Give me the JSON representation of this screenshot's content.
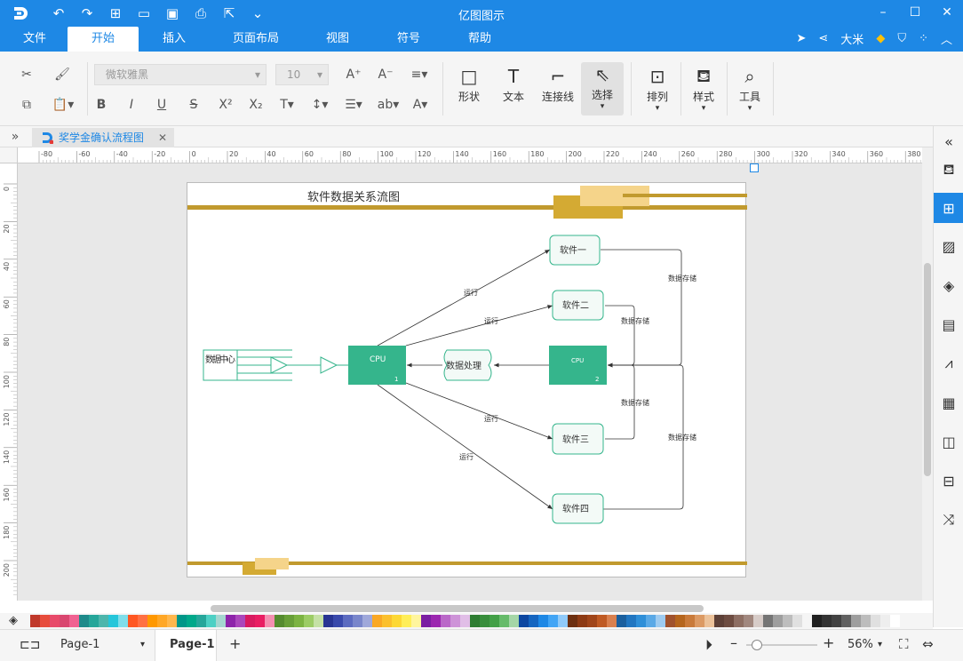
{
  "app": {
    "title": "亿图图示"
  },
  "menu": {
    "items": [
      "文件",
      "开始",
      "插入",
      "页面布局",
      "视图",
      "符号",
      "帮助"
    ],
    "active": "开始",
    "user": "大米"
  },
  "ribbon": {
    "font_name": "微软雅黑",
    "font_size": "10",
    "shape_label": "形状",
    "text_label": "文本",
    "connector_label": "连接线",
    "select_label": "选择",
    "arrange_label": "排列",
    "style_label": "样式",
    "tools_label": "工具"
  },
  "doc_tab": {
    "name": "奖学金确认流程图"
  },
  "ruler": {
    "h_ticks": [
      "-80",
      "-60",
      "-40",
      "-20",
      "0",
      "20",
      "40",
      "60",
      "80",
      "100",
      "120",
      "140",
      "160",
      "180",
      "200",
      "220",
      "240",
      "260",
      "280",
      "300",
      "320",
      "340",
      "360",
      "380"
    ],
    "v_ticks": [
      "0",
      "20",
      "40",
      "60",
      "80",
      "100",
      "120",
      "140",
      "160",
      "180",
      "200"
    ]
  },
  "diagram": {
    "title": "软件数据关系流图",
    "data_center": "数据中心",
    "cpu1": {
      "label": "CPU",
      "num": "1"
    },
    "cpu2": {
      "label": "CPU",
      "num": "2"
    },
    "process": "数据处理",
    "software": [
      "软件一",
      "软件二",
      "软件三",
      "软件四"
    ],
    "run_label": "运行",
    "store_label": "数据存储"
  },
  "colors": {
    "accent": "#1e88e5",
    "node_green": "#35b58c",
    "gold": "#c19a2e",
    "gold_light": "#f5d48a",
    "gold_mid": "#d4aa33"
  },
  "palette": [
    "#c0392b",
    "#e74c3c",
    "#e84a6a",
    "#d9466f",
    "#f06292",
    "#1e8a8a",
    "#26a69a",
    "#4db6ac",
    "#26c6da",
    "#80deea",
    "#ff5722",
    "#ff7043",
    "#ff9800",
    "#ffa726",
    "#ffb74d",
    "#009688",
    "#00a88a",
    "#26a69a",
    "#4dd0c4",
    "#a5d6d0",
    "#8e24aa",
    "#ab47bc",
    "#d81b60",
    "#e91e63",
    "#f48fb1",
    "#558b2f",
    "#689f38",
    "#7cb342",
    "#9ccc65",
    "#c5e1a5",
    "#283593",
    "#3949ab",
    "#5c6bc0",
    "#7986cb",
    "#9fa8da",
    "#f9a825",
    "#fbc02d",
    "#fdd835",
    "#ffee58",
    "#fff59d",
    "#7b1fa2",
    "#9c27b0",
    "#ba68c8",
    "#ce93d8",
    "#e1bee7",
    "#2e7d32",
    "#388e3c",
    "#43a047",
    "#66bb6a",
    "#a5d6a7",
    "#0d47a1",
    "#1565c0",
    "#1e88e5",
    "#42a5f5",
    "#90caf9",
    "#6d2f10",
    "#8d3a14",
    "#a0451a",
    "#bf5a24",
    "#d9804f",
    "#1a5f9e",
    "#2176c1",
    "#2f8fd8",
    "#5aa9e6",
    "#9ecbf0",
    "#a0522d",
    "#b5651d",
    "#c97a3a",
    "#dc9a64",
    "#ecc29a",
    "#5d4037",
    "#6d4c41",
    "#8d6e63",
    "#a1887f",
    "#d7ccc8",
    "#757575",
    "#9e9e9e",
    "#bdbdbd",
    "#e0e0e0",
    "#f5f5f5",
    "#212121",
    "#333333",
    "#424242",
    "#616161",
    "#9e9e9e",
    "#bdbdbd",
    "#e0e0e0",
    "#eeeeee",
    "#ffffff"
  ],
  "status": {
    "page_select": "Page-1",
    "page_tab": "Page-1",
    "zoom": "56%"
  }
}
